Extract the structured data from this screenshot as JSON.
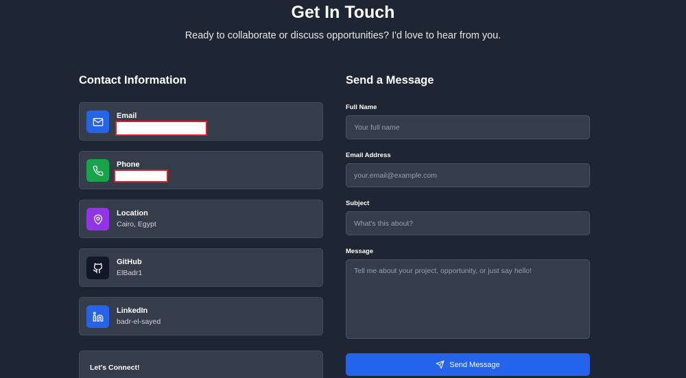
{
  "hero": {
    "title": "Get In Touch",
    "subtitle": "Ready to collaborate or discuss opportunities? I'd love to hear from you."
  },
  "contact": {
    "heading": "Contact Information",
    "items": [
      {
        "label": "Email",
        "value": "",
        "icon": "mail-icon",
        "color": "#2563eb"
      },
      {
        "label": "Phone",
        "value": "",
        "icon": "phone-icon",
        "color": "#16a34a"
      },
      {
        "label": "Location",
        "value": "Cairo, Egypt",
        "icon": "map-pin-icon",
        "color": "#9333ea"
      },
      {
        "label": "GitHub",
        "value": "ElBadr1",
        "icon": "github-icon",
        "color": "#111827"
      },
      {
        "label": "LinkedIn",
        "value": "badr-el-sayed",
        "icon": "linkedin-icon",
        "color": "#2563eb"
      }
    ],
    "connect_title": "Let's Connect!"
  },
  "form": {
    "heading": "Send a Message",
    "name_label": "Full Name",
    "name_placeholder": "Your full name",
    "email_label": "Email Address",
    "email_placeholder": "your.email@example.com",
    "subject_label": "Subject",
    "subject_placeholder": "What's this about?",
    "message_label": "Message",
    "message_placeholder": "Tell me about your project, opportunity, or just say hello!",
    "submit_label": "Send Message"
  },
  "colors": {
    "background": "#1e2533",
    "card": "#353c4a",
    "accent": "#2563eb",
    "redaction_border": "#e11d2a"
  }
}
